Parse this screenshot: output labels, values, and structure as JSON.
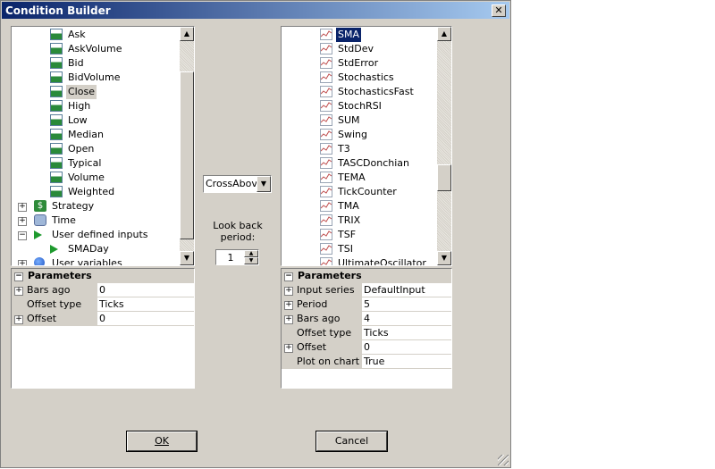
{
  "window": {
    "title": "Condition Builder",
    "close_glyph": "✕"
  },
  "left_tree": {
    "items": [
      {
        "label": "Ask",
        "icon": "bar-chart-icon",
        "level": 2
      },
      {
        "label": "AskVolume",
        "icon": "bar-chart-icon",
        "level": 2
      },
      {
        "label": "Bid",
        "icon": "bar-chart-icon",
        "level": 2
      },
      {
        "label": "BidVolume",
        "icon": "bar-chart-icon",
        "level": 2
      },
      {
        "label": "Close",
        "icon": "bar-chart-icon",
        "level": 2,
        "selected": true
      },
      {
        "label": "High",
        "icon": "bar-chart-icon",
        "level": 2
      },
      {
        "label": "Low",
        "icon": "bar-chart-icon",
        "level": 2
      },
      {
        "label": "Median",
        "icon": "bar-chart-icon",
        "level": 2
      },
      {
        "label": "Open",
        "icon": "bar-chart-icon",
        "level": 2
      },
      {
        "label": "Typical",
        "icon": "bar-chart-icon",
        "level": 2
      },
      {
        "label": "Volume",
        "icon": "bar-chart-icon",
        "level": 2
      },
      {
        "label": "Weighted",
        "icon": "bar-chart-icon",
        "level": 2
      },
      {
        "label": "Strategy",
        "icon": "dollar-icon",
        "level": 1,
        "expander": "+"
      },
      {
        "label": "Time",
        "icon": "clock-icon",
        "level": 1,
        "expander": "+"
      },
      {
        "label": "User defined inputs",
        "icon": "play-icon",
        "level": 1,
        "expander": "−"
      },
      {
        "label": "SMADay",
        "icon": "play-icon",
        "level": 2
      },
      {
        "label": "User variables",
        "icon": "globe-icon",
        "level": 1,
        "expander": "+"
      }
    ]
  },
  "right_tree": {
    "items": [
      {
        "label": "SMA",
        "selected": true
      },
      {
        "label": "StdDev"
      },
      {
        "label": "StdError"
      },
      {
        "label": "Stochastics"
      },
      {
        "label": "StochasticsFast"
      },
      {
        "label": "StochRSI"
      },
      {
        "label": "SUM"
      },
      {
        "label": "Swing"
      },
      {
        "label": "T3"
      },
      {
        "label": "TASCDonchian"
      },
      {
        "label": "TEMA"
      },
      {
        "label": "TickCounter"
      },
      {
        "label": "TMA"
      },
      {
        "label": "TRIX"
      },
      {
        "label": "TSF"
      },
      {
        "label": "TSI"
      },
      {
        "label": "UltimateOscillator"
      }
    ]
  },
  "left_params": {
    "header": "Parameters",
    "header_expander": "−",
    "rows": [
      {
        "name": "Bars ago",
        "value": "0",
        "expander": "+"
      },
      {
        "name": "Offset type",
        "value": "Ticks"
      },
      {
        "name": "Offset",
        "value": "0",
        "expander": "+"
      }
    ]
  },
  "right_params": {
    "header": "Parameters",
    "header_expander": "−",
    "rows": [
      {
        "name": "Input series",
        "value": "DefaultInput",
        "expander": "+"
      },
      {
        "name": "Period",
        "value": "5",
        "expander": "+"
      },
      {
        "name": "Bars ago",
        "value": "4",
        "expander": "+"
      },
      {
        "name": "Offset type",
        "value": "Ticks"
      },
      {
        "name": "Offset",
        "value": "0",
        "expander": "+"
      },
      {
        "name": "Plot on chart",
        "value": "True"
      }
    ]
  },
  "operator": {
    "value": "CrossAbove"
  },
  "lookback": {
    "label": "Look back period:",
    "value": "1"
  },
  "buttons": {
    "ok": "OK",
    "cancel": "Cancel"
  },
  "glyphs": {
    "up": "▲",
    "down": "▼"
  }
}
